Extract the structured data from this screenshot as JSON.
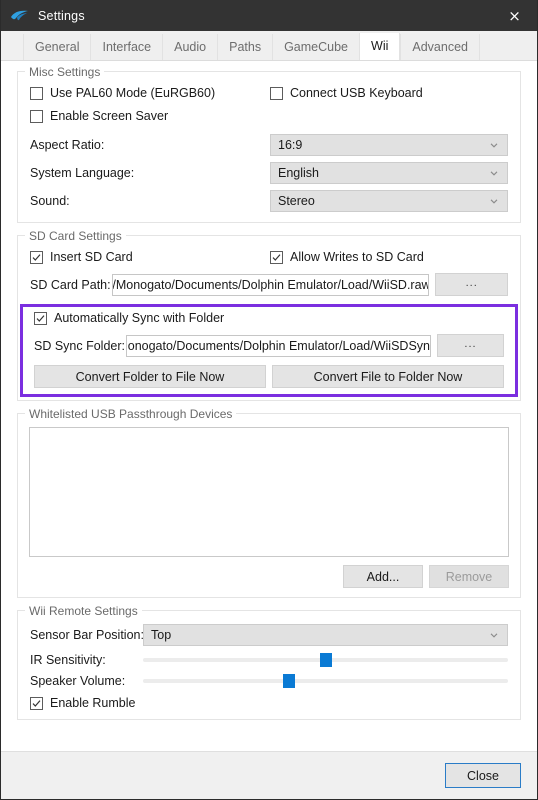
{
  "window": {
    "title": "Settings",
    "app_icon": "dolphin-icon",
    "close_icon": "×"
  },
  "tabs": [
    {
      "label": "General",
      "active": false
    },
    {
      "label": "Interface",
      "active": false
    },
    {
      "label": "Audio",
      "active": false
    },
    {
      "label": "Paths",
      "active": false
    },
    {
      "label": "GameCube",
      "active": false
    },
    {
      "label": "Wii",
      "active": true
    },
    {
      "label": "Advanced",
      "active": false
    }
  ],
  "misc_settings": {
    "title": "Misc Settings",
    "use_pal60": {
      "label": "Use PAL60 Mode (EuRGB60)",
      "checked": false
    },
    "connect_usb_keyboard": {
      "label": "Connect USB Keyboard",
      "checked": false
    },
    "enable_screen_saver": {
      "label": "Enable Screen Saver",
      "checked": false
    },
    "aspect_ratio": {
      "label": "Aspect Ratio:",
      "value": "16:9"
    },
    "system_language": {
      "label": "System Language:",
      "value": "English"
    },
    "sound": {
      "label": "Sound:",
      "value": "Stereo"
    }
  },
  "sd_card_settings": {
    "title": "SD Card Settings",
    "insert_sd_card": {
      "label": "Insert SD Card",
      "checked": true
    },
    "allow_writes": {
      "label": "Allow Writes to SD Card",
      "checked": true
    },
    "sd_card_path": {
      "label": "SD Card Path:",
      "value": "/Monogato/Documents/Dolphin Emulator/Load/WiiSD.raw",
      "browse_label": "..."
    },
    "auto_sync": {
      "label": "Automatically Sync with Folder",
      "checked": true
    },
    "sd_sync_folder": {
      "label": "SD Sync Folder:",
      "value": "onogato/Documents/Dolphin Emulator/Load/WiiSDSync/",
      "browse_label": "..."
    },
    "convert_folder_to_file": "Convert Folder to File Now",
    "convert_file_to_folder": "Convert File to Folder Now",
    "highlight_color": "#7b2ee0"
  },
  "usb_passthrough": {
    "title": "Whitelisted USB Passthrough Devices",
    "devices": [],
    "add_label": "Add...",
    "remove_label": "Remove",
    "remove_enabled": false
  },
  "wii_remote_settings": {
    "title": "Wii Remote Settings",
    "sensor_bar_position": {
      "label": "Sensor Bar Position:",
      "value": "Top"
    },
    "ir_sensitivity": {
      "label": "IR Sensitivity:",
      "percent": 50
    },
    "speaker_volume": {
      "label": "Speaker Volume:",
      "percent": 40
    },
    "enable_rumble": {
      "label": "Enable Rumble",
      "checked": true
    }
  },
  "footer": {
    "close_label": "Close"
  }
}
